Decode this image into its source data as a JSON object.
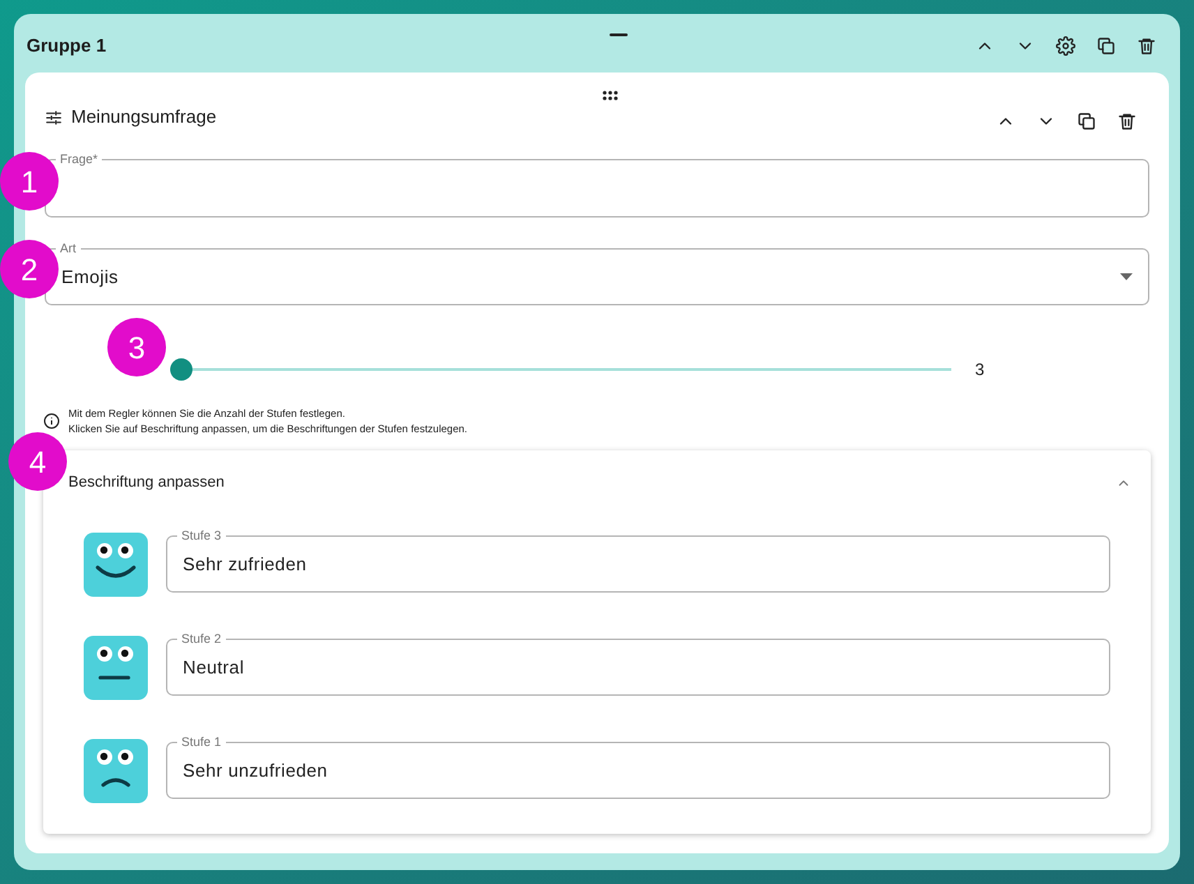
{
  "group": {
    "title": "Gruppe 1"
  },
  "question": {
    "title": "Meinungsumfrage",
    "frage_field": {
      "label": "Frage*"
    },
    "art_field": {
      "label": "Art",
      "value": "Emojis"
    },
    "slider": {
      "level": 0,
      "reading": "3"
    },
    "info": [
      "Mit dem Regler können Sie die Anzahl der Stufen festlegen.",
      "Klicken Sie auf Beschriftung anpassen, um die Beschriftungen der Stufen festzulegen."
    ],
    "labels_panel": {
      "title": "Beschriftung anpassen",
      "expanded": true,
      "levels": [
        {
          "kind": "happy",
          "label": "Stufe 3",
          "value": "Sehr zufrieden"
        },
        {
          "kind": "neutral",
          "label": "Stufe 2",
          "value": "Neutral"
        },
        {
          "kind": "sad",
          "label": "Stufe 1",
          "value": "Sehr unzufrieden"
        }
      ]
    }
  },
  "annotations": [
    "1",
    "2",
    "3",
    "4"
  ]
}
